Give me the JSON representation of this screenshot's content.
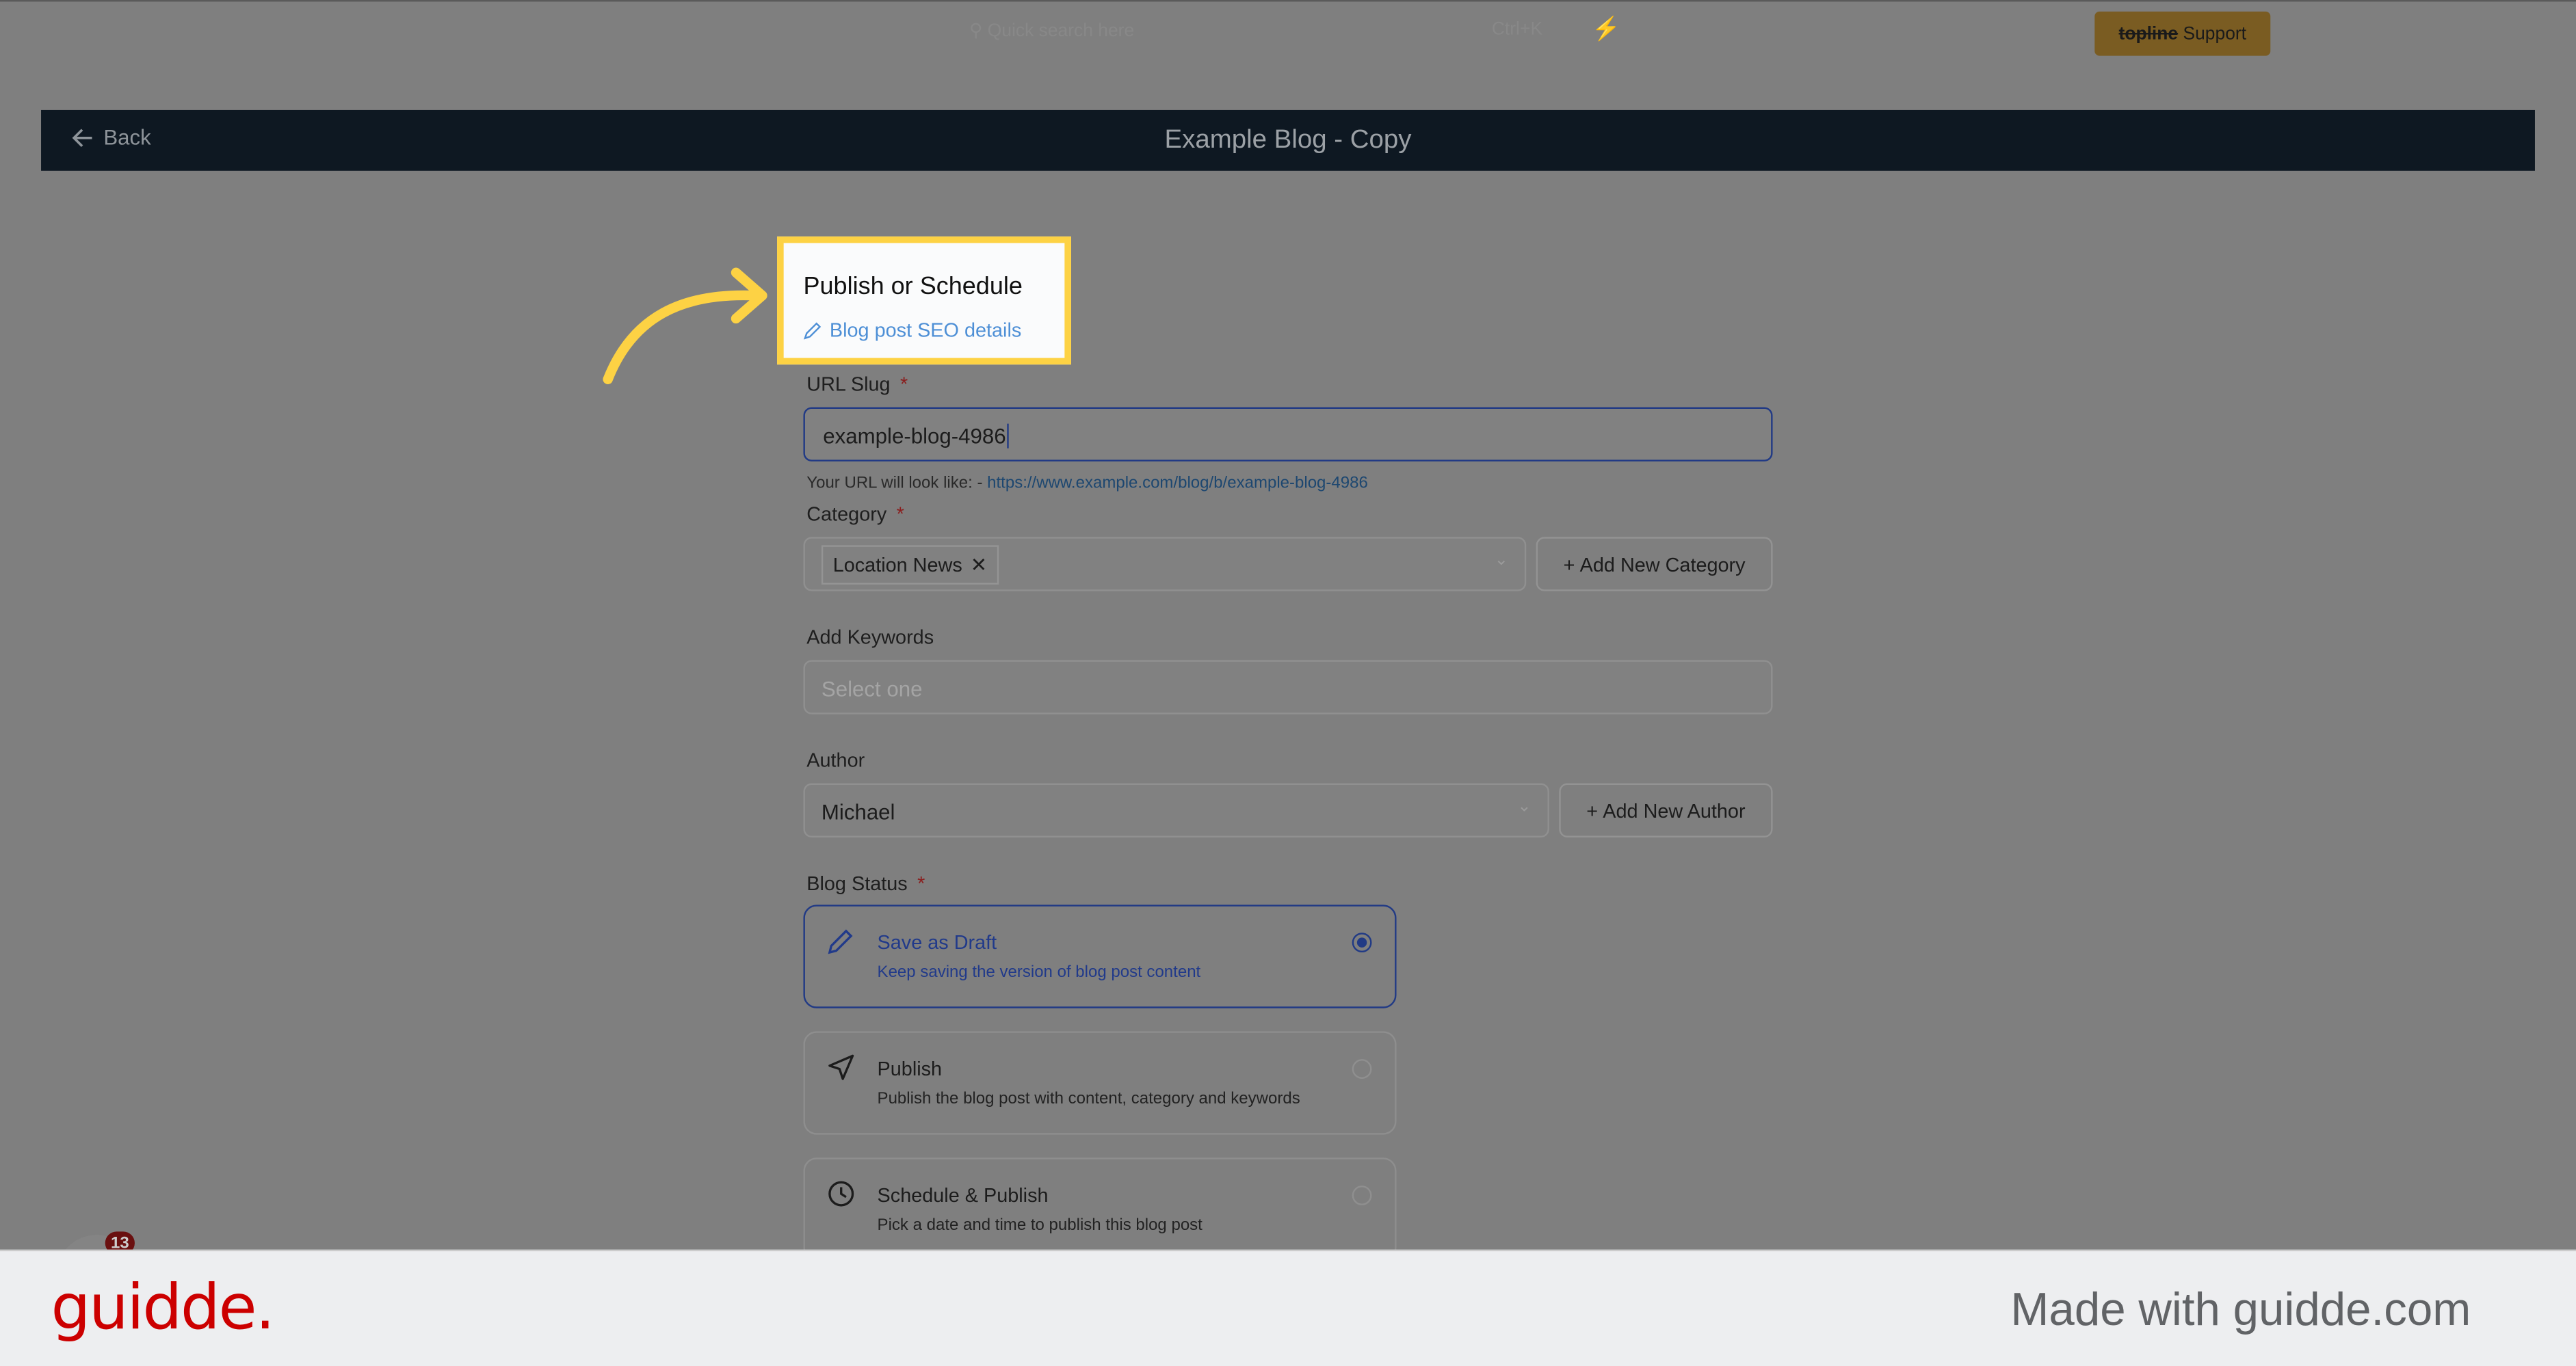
{
  "topbar": {
    "search_placeholder": "Quick search here",
    "shortcut": "Ctrl+K",
    "support_brand": "topline",
    "support_label": "Support"
  },
  "header": {
    "back_label": "Back",
    "title": "Example Blog - Copy"
  },
  "highlight": {
    "title": "Publish or Schedule",
    "link": "Blog post SEO details",
    "color": "#fdd244"
  },
  "form": {
    "slug": {
      "label": "URL Slug",
      "value": "example-blog-4986",
      "hint_prefix": "Your URL will look like: -",
      "hint_url": "https://www.example.com/blog/b/example-blog-4986"
    },
    "category": {
      "label": "Category",
      "chip": "Location News",
      "add_label": "Add New Category"
    },
    "keywords": {
      "label": "Add Keywords",
      "placeholder": "Select one"
    },
    "author": {
      "label": "Author",
      "value": "Michael",
      "add_label": "Add New Author"
    },
    "status": {
      "label": "Blog Status",
      "options": [
        {
          "title": "Save as Draft",
          "desc": "Keep saving the version of blog post content",
          "icon": "pencil-icon",
          "selected": true
        },
        {
          "title": "Publish",
          "desc": "Publish the blog post with content, category and keywords",
          "icon": "send-icon",
          "selected": false
        },
        {
          "title": "Schedule & Publish",
          "desc": "Pick a date and time to publish this blog post",
          "icon": "clock-icon",
          "selected": false
        }
      ]
    }
  },
  "notification_count": "13",
  "footer": {
    "logo": "guidde.",
    "tagline": "Made with guidde.com",
    "brand_color": "#cc0000"
  }
}
